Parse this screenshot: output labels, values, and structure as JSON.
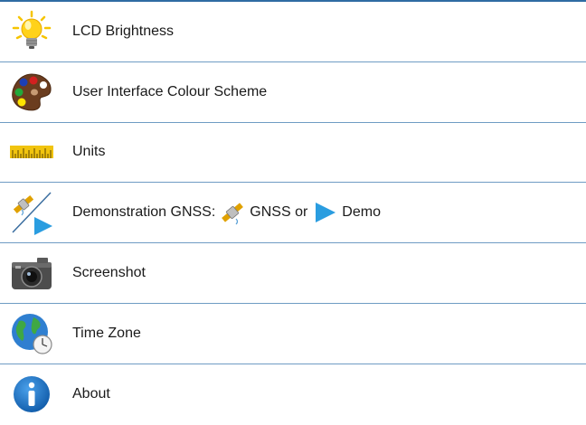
{
  "menu": {
    "items": [
      {
        "label": "LCD Brightness",
        "icon": "lightbulb-icon"
      },
      {
        "label": "User Interface Colour Scheme",
        "icon": "palette-icon"
      },
      {
        "label": "Units",
        "icon": "ruler-icon"
      },
      {
        "label_prefix": "Demonstration GNSS:",
        "label_gnss": "GNSS or",
        "label_demo": "Demo",
        "icon": "satellite-demo-icon"
      },
      {
        "label": "Screenshot",
        "icon": "camera-icon"
      },
      {
        "label": "Time Zone",
        "icon": "globe-clock-icon"
      },
      {
        "label": "About",
        "icon": "info-icon"
      }
    ]
  },
  "colors": {
    "divider": "#6f9cc4",
    "top_border": "#2f6ca3",
    "demo_arrow": "#2a9de0"
  }
}
